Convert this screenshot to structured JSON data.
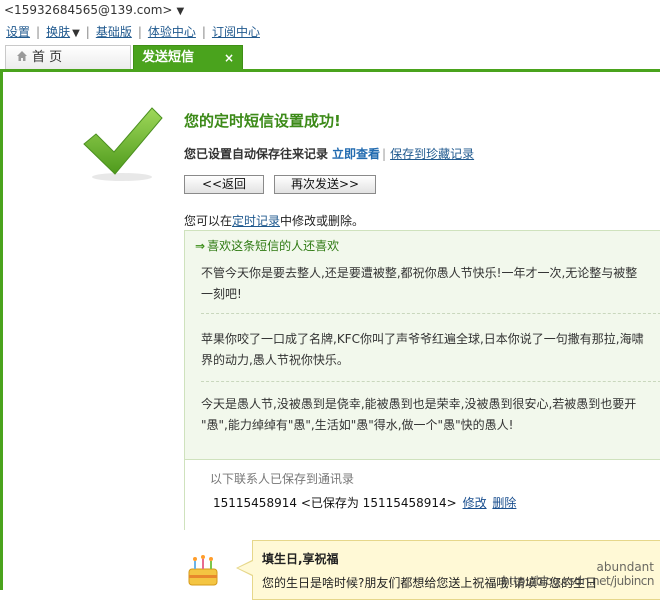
{
  "account": {
    "email": "<15932684565@139.com>",
    "menu_icon": "caret-down"
  },
  "topnav": {
    "items": [
      "设置",
      "换肤",
      "基础版",
      "体验中心",
      "订阅中心"
    ],
    "separator": "|"
  },
  "tabs": [
    {
      "label": "首 页",
      "icon": "home-icon"
    },
    {
      "label": "发送短信",
      "close": "×"
    }
  ],
  "colors": {
    "brand_green": "#4aa31d",
    "title_green": "#3c8a18",
    "panel_bg": "#f2f8ec"
  },
  "success": {
    "title": "您的定时短信设置成功!",
    "saved_prefix": "您已设置自动保存往来记录",
    "view_now": "立即查看",
    "pipe": "|",
    "save_fav": "保存到珍藏记录"
  },
  "buttons": {
    "back": "<<返回",
    "resend": "再次发送>>"
  },
  "modify": {
    "prefix": "您可以在",
    "link": "定时记录",
    "suffix": "中修改或删除。"
  },
  "panel": {
    "arrow": "⇒",
    "heading": "喜欢这条短信的人还喜欢",
    "messages": [
      [
        "不管今天你是要去整人,还是要遭被整,都祝你愚人节快乐!一年才一次,无论整与被整",
        "一刻吧!"
      ],
      [
        "苹果你咬了一口成了名牌,KFC你叫了声爷爷红遍全球,日本你说了一句撒有那拉,海啸",
        "界的动力,愚人节祝你快乐。"
      ],
      [
        "今天是愚人节,没被愚到是侥幸,能被愚到也是荣幸,没被愚到很安心,若被愚到也要开",
        "\"愚\",能力绰绰有\"愚\",生活如\"愚\"得水,做一个\"愚\"快的愚人!"
      ]
    ],
    "contact_label": "以下联系人已保存到通讯录",
    "contact_number": "15115458914",
    "contact_saved": "<已保存为 15115458914>",
    "edit": "修改",
    "delete": "删除"
  },
  "birthday": {
    "icon": "cake-icon",
    "title": "填生日,享祝福",
    "text": "您的生日是啥时候?朋友们都想给您送上祝福哦!请填写您的生日"
  },
  "watermark": {
    "line1": "abundant",
    "line2": "http://blog.csdn.net/jubincn"
  }
}
